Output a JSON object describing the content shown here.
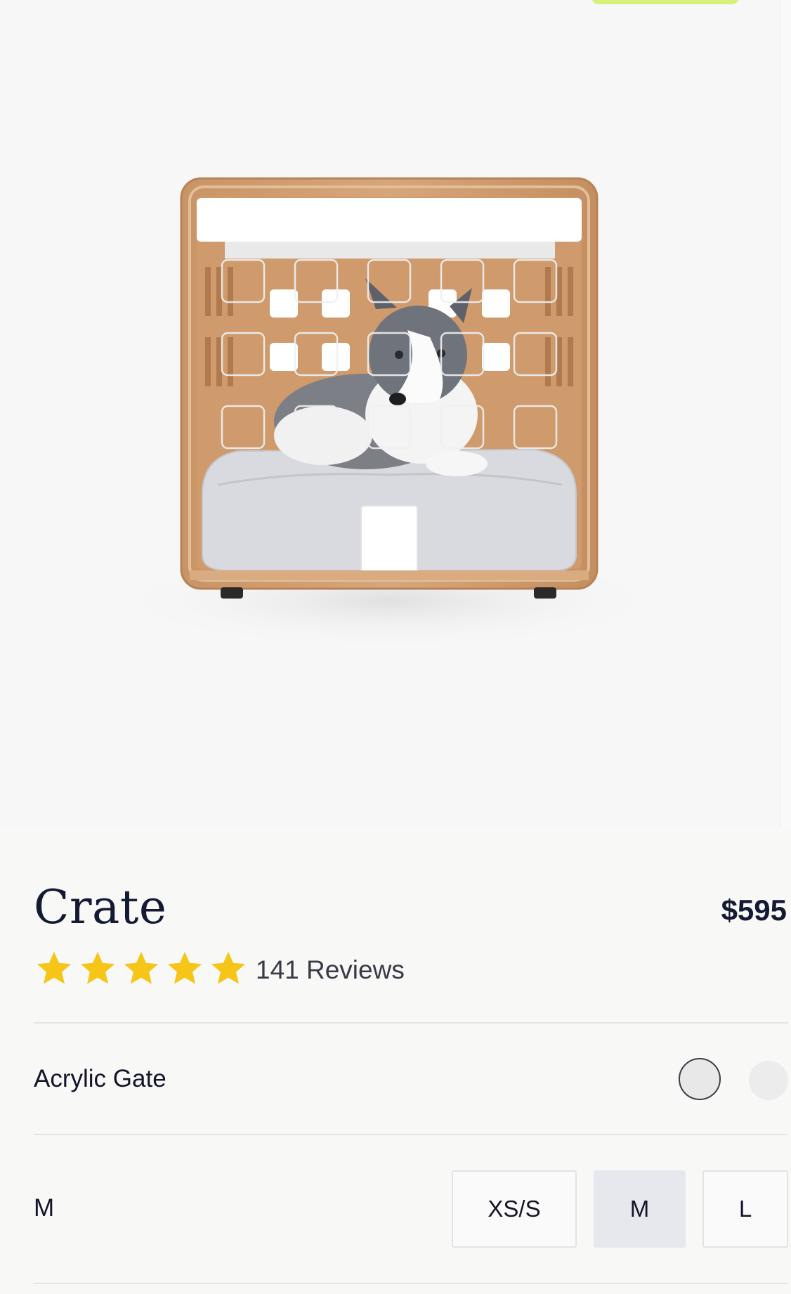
{
  "product": {
    "title": "Crate",
    "price": "$595",
    "rating_stars": 5,
    "reviews_label": "141 Reviews",
    "image_alt": "Dog crate with dog"
  },
  "options": {
    "gate": {
      "label": "Acrylic Gate",
      "swatches": [
        {
          "name": "acrylic-clear",
          "selected": true
        },
        {
          "name": "next-option",
          "selected": false
        }
      ]
    },
    "size": {
      "current_label": "M",
      "choices": [
        {
          "label": "XS/S",
          "selected": false
        },
        {
          "label": "M",
          "selected": true
        },
        {
          "label": "L",
          "selected": false
        }
      ]
    }
  },
  "colors": {
    "star": "#f5c518",
    "promo_tab": "#d7f07a",
    "selected_size_bg": "#e6e8ee"
  }
}
